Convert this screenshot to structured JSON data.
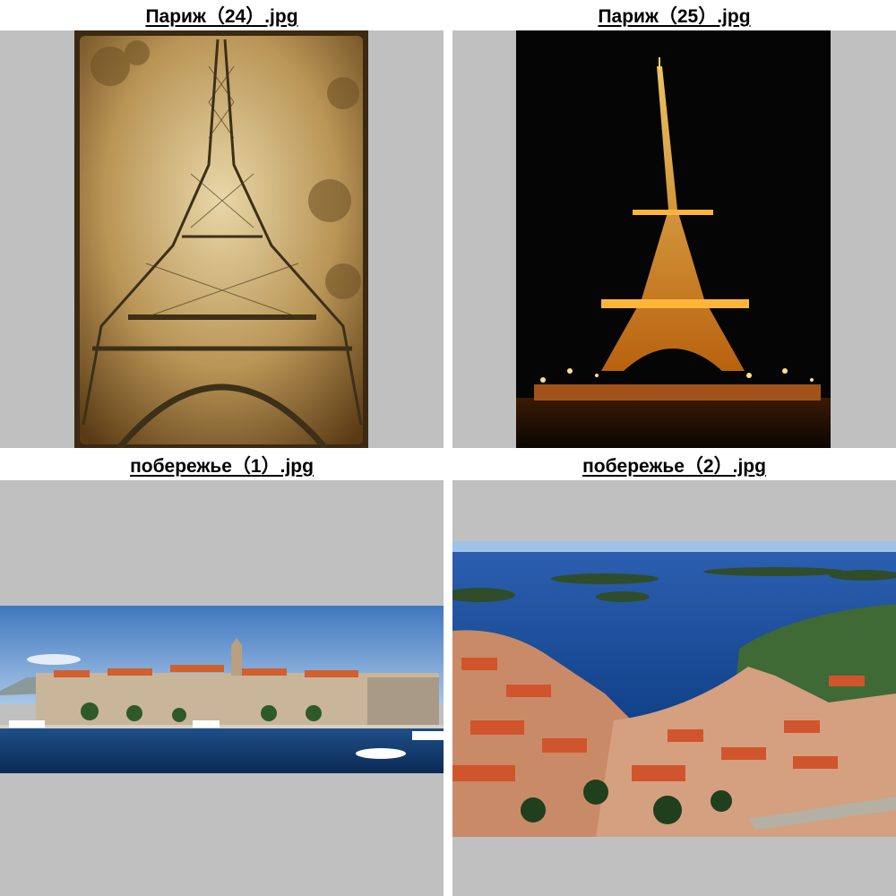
{
  "gallery": {
    "items": [
      {
        "filename": "Париж（24）.jpg",
        "image": "eiffel-tower-vintage-sepia"
      },
      {
        "filename": "Париж（25）.jpg",
        "image": "eiffel-tower-night-lights"
      },
      {
        "filename": "побережье（1）.jpg",
        "image": "coastal-old-town-panorama"
      },
      {
        "filename": "побережье（2）.jpg",
        "image": "harbor-town-aerial-islands"
      }
    ]
  },
  "colors": {
    "frame_background": "#c0c0c0",
    "page_background": "#ffffff"
  }
}
